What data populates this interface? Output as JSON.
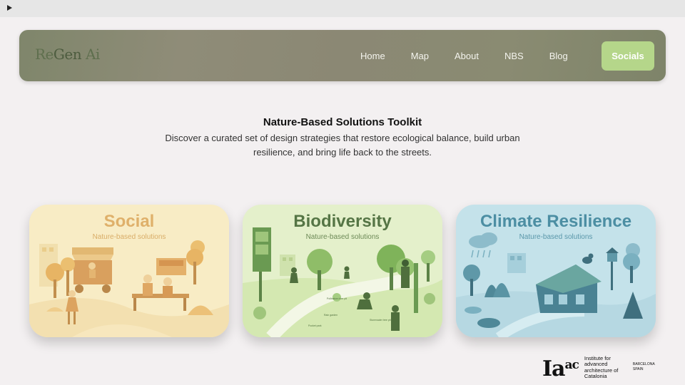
{
  "browser": {
    "play_icon": "play-triangle-icon"
  },
  "nav": {
    "logo_re": "Re",
    "logo_gen": "Gen",
    "logo_ai": " Ai",
    "links": [
      "Home",
      "Map",
      "About",
      "NBS",
      "Blog"
    ],
    "socials_label": "Socials",
    "socials_color": "#b5d68a"
  },
  "hero": {
    "title": "Nature-Based Solutions Toolkit",
    "description": "Discover a curated set of design strategies that restore ecological balance, build urban resilience, and bring life back to the streets."
  },
  "cards": [
    {
      "title": "Social",
      "subtitle": "Nature-based solutions",
      "accent": "#dfb06a"
    },
    {
      "title": "Biodiversity",
      "subtitle": "Nature-based solutions",
      "accent": "#557545",
      "illustration_labels": [
        "Pollinators tree pit",
        "Rain garden",
        "Pocket park",
        "Stormwater tree pit"
      ]
    },
    {
      "title": "Climate Resilience",
      "subtitle": "Nature-based solutions",
      "accent": "#4c8ea3"
    }
  ],
  "footer": {
    "logo_main": "Ia",
    "logo_sup": "ac",
    "logo_text": "Institute for advanced architecture of Catalonia",
    "place_line1": "BARCELONA",
    "place_line2": "SPAIN"
  }
}
